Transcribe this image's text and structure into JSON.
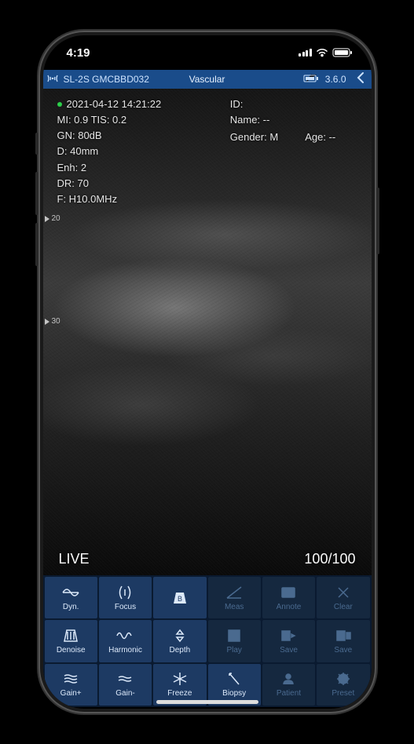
{
  "status_bar": {
    "time": "4:19"
  },
  "app_header": {
    "probe_id": "SL-2S GMCBBD032",
    "preset": "Vascular",
    "version": "3.6.0"
  },
  "patient": {
    "id_label": "ID:",
    "id_value": "",
    "name_label": "Name:",
    "name_value": "--",
    "gender_label": "Gender:",
    "gender_value": "M",
    "age_label": "Age:",
    "age_value": "--"
  },
  "scan_params": {
    "timestamp": "2021-04-12 14:21:22",
    "mi_tis": "MI: 0.9  TIS: 0.2",
    "gain": "GN: 80dB",
    "depth": "D: 40mm",
    "enhance": "Enh: 2",
    "dr": "DR: 70",
    "freq": "F: H10.0MHz"
  },
  "ruler": {
    "m20": "20",
    "m30": "30"
  },
  "scan_status": {
    "mode": "LIVE",
    "frame": "100/100"
  },
  "controls": {
    "dyn": "Dyn.",
    "focus": "Focus",
    "bmode": "B",
    "meas": "Meas",
    "annote": "Annote",
    "clear": "Clear",
    "denoise": "Denoise",
    "harmonic": "Harmonic",
    "depth": "Depth",
    "play": "Play",
    "save1": "Save",
    "save2": "Save",
    "gain_plus": "Gain+",
    "gain_minus": "Gain-",
    "freeze": "Freeze",
    "biopsy": "Biopsy",
    "patient": "Patient",
    "preset": "Preset"
  }
}
